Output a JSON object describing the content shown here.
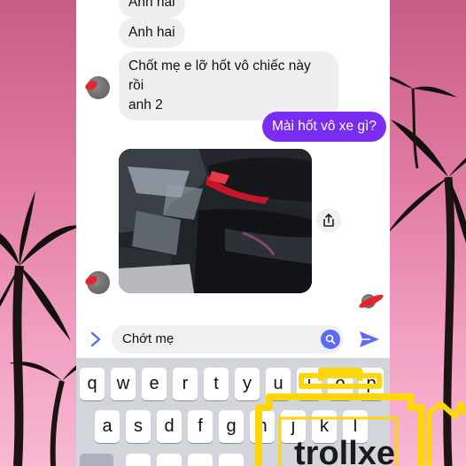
{
  "thread": {
    "msg_partial": "Anh hai",
    "msg1": "Anh hai",
    "msg2_line1": "Chốt mẹ e lỡ hốt vô chiếc này rồi",
    "msg2_line2": "anh 2",
    "msg3": "Mài hốt vô xe gì?"
  },
  "composer": {
    "input_value": "Chớt mẹ"
  },
  "keyboard": {
    "row1": [
      "q",
      "w",
      "e",
      "r",
      "t",
      "y",
      "u",
      "i",
      "o",
      "p"
    ],
    "row2": [
      "a",
      "s",
      "d",
      "f",
      "g",
      "h",
      "j",
      "k",
      "l"
    ]
  },
  "watermark": {
    "text": "trollxe"
  },
  "colors": {
    "outgoing_bubble": "#7a2cf0",
    "incoming_bubble": "#efeff1",
    "accent": "#5b6cf3",
    "keyboard_bg": "#d3d5dc",
    "logo_yellow": "#ffd60a"
  }
}
